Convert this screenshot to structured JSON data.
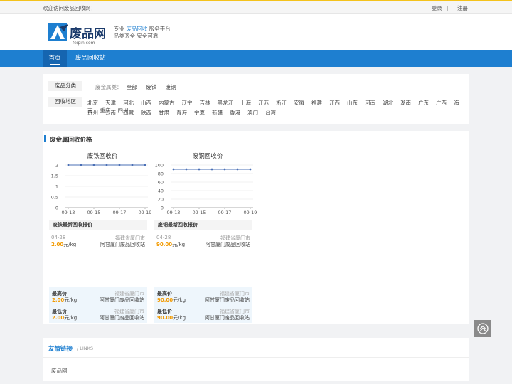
{
  "topbar": {
    "welcome": "欢迎访问废品回收网！",
    "login": "登录",
    "separator": "|",
    "register": "注册"
  },
  "header": {
    "logo_text": "废品网",
    "logo_sub": "feipin.com",
    "slogan_pre": "专业",
    "slogan_highlight": "废品回收",
    "slogan_post": "服务平台",
    "slogan_line2": "品类齐全 安全可靠"
  },
  "nav": {
    "home": "首页",
    "station": "废品回收站"
  },
  "filter": {
    "category_label": "废品分类",
    "category_sub": "废金属类：",
    "categories": [
      "全部",
      "废铁",
      "废铜"
    ],
    "region_label": "回收地区",
    "regions_row1": [
      "北京",
      "天津",
      "河北",
      "山西",
      "内蒙古",
      "辽宁",
      "吉林",
      "黑龙江",
      "上海",
      "江苏",
      "浙江",
      "安徽",
      "福建",
      "江西",
      "山东",
      "河南",
      "湖北",
      "湖南",
      "广东",
      "广西",
      "海南",
      "重庆",
      "四川"
    ],
    "regions_row2": [
      "贵州",
      "云南",
      "西藏",
      "陕西",
      "甘肃",
      "青海",
      "宁夏",
      "新疆",
      "香港",
      "澳门",
      "台湾"
    ]
  },
  "price_section": {
    "title": "废金属回收价格"
  },
  "chart_data": [
    {
      "type": "line",
      "title": "废铁回收价",
      "x": [
        "09-13",
        "09-14",
        "09-15",
        "09-16",
        "09-17",
        "09-18",
        "09-19"
      ],
      "x_tick_labels": [
        "09-13",
        "09-15",
        "09-17",
        "09-19"
      ],
      "series": [
        {
          "values": [
            2,
            2,
            2,
            2,
            2,
            2,
            2
          ]
        }
      ],
      "y_ticks": [
        "0",
        "0.5",
        "1",
        "1.5",
        "2"
      ],
      "ylim": [
        0,
        2
      ],
      "grid": true
    },
    {
      "type": "line",
      "title": "废铜回收价",
      "x": [
        "09-13",
        "09-14",
        "09-15",
        "09-16",
        "09-17",
        "09-18",
        "09-19"
      ],
      "x_tick_labels": [
        "09-13",
        "09-15",
        "09-17",
        "09-19"
      ],
      "series": [
        {
          "values": [
            90,
            90,
            90,
            90,
            90,
            90,
            90
          ]
        }
      ],
      "y_ticks": [
        "0",
        "20",
        "40",
        "60",
        "80",
        "100"
      ],
      "ylim": [
        0,
        100
      ],
      "grid": true
    }
  ],
  "latest": {
    "iron": {
      "header": "废铁最新回收报价",
      "date": "04-28",
      "location": "福建省厦门市",
      "price": "2.00",
      "unit": "元/kg",
      "station": "阿甘厦门废品回收站"
    },
    "copper": {
      "header": "废铜最新回收报价",
      "date": "04-28",
      "location": "福建省厦门市",
      "price": "90.00",
      "unit": "元/kg",
      "station": "阿甘厦门废品回收站"
    }
  },
  "minmax": {
    "iron": {
      "max_label": "最高价",
      "max_price": "2.00",
      "max_unit": "元/kg",
      "max_location": "福建省厦门市",
      "max_station": "阿甘厦门废品回收站",
      "min_label": "最低价",
      "min_price": "2.00",
      "min_unit": "元/kg",
      "min_location": "福建省厦门市",
      "min_station": "阿甘厦门废品回收站"
    },
    "copper": {
      "max_label": "最高价",
      "max_price": "90.00",
      "max_unit": "元/kg",
      "max_location": "福建省厦门市",
      "max_station": "阿甘厦门废品回收站",
      "min_label": "最低价",
      "min_price": "90.00",
      "min_unit": "元/kg",
      "min_location": "福建省厦门市",
      "min_station": "阿甘厦门废品回收站"
    }
  },
  "links": {
    "title": "友情链接",
    "subtitle": "/ LINKS",
    "items": [
      "废品网"
    ]
  },
  "colors": {
    "primary": "#1e7fd0",
    "price": "#f29a00",
    "line": "#4a6fb5",
    "topline": "#f4c21b"
  }
}
